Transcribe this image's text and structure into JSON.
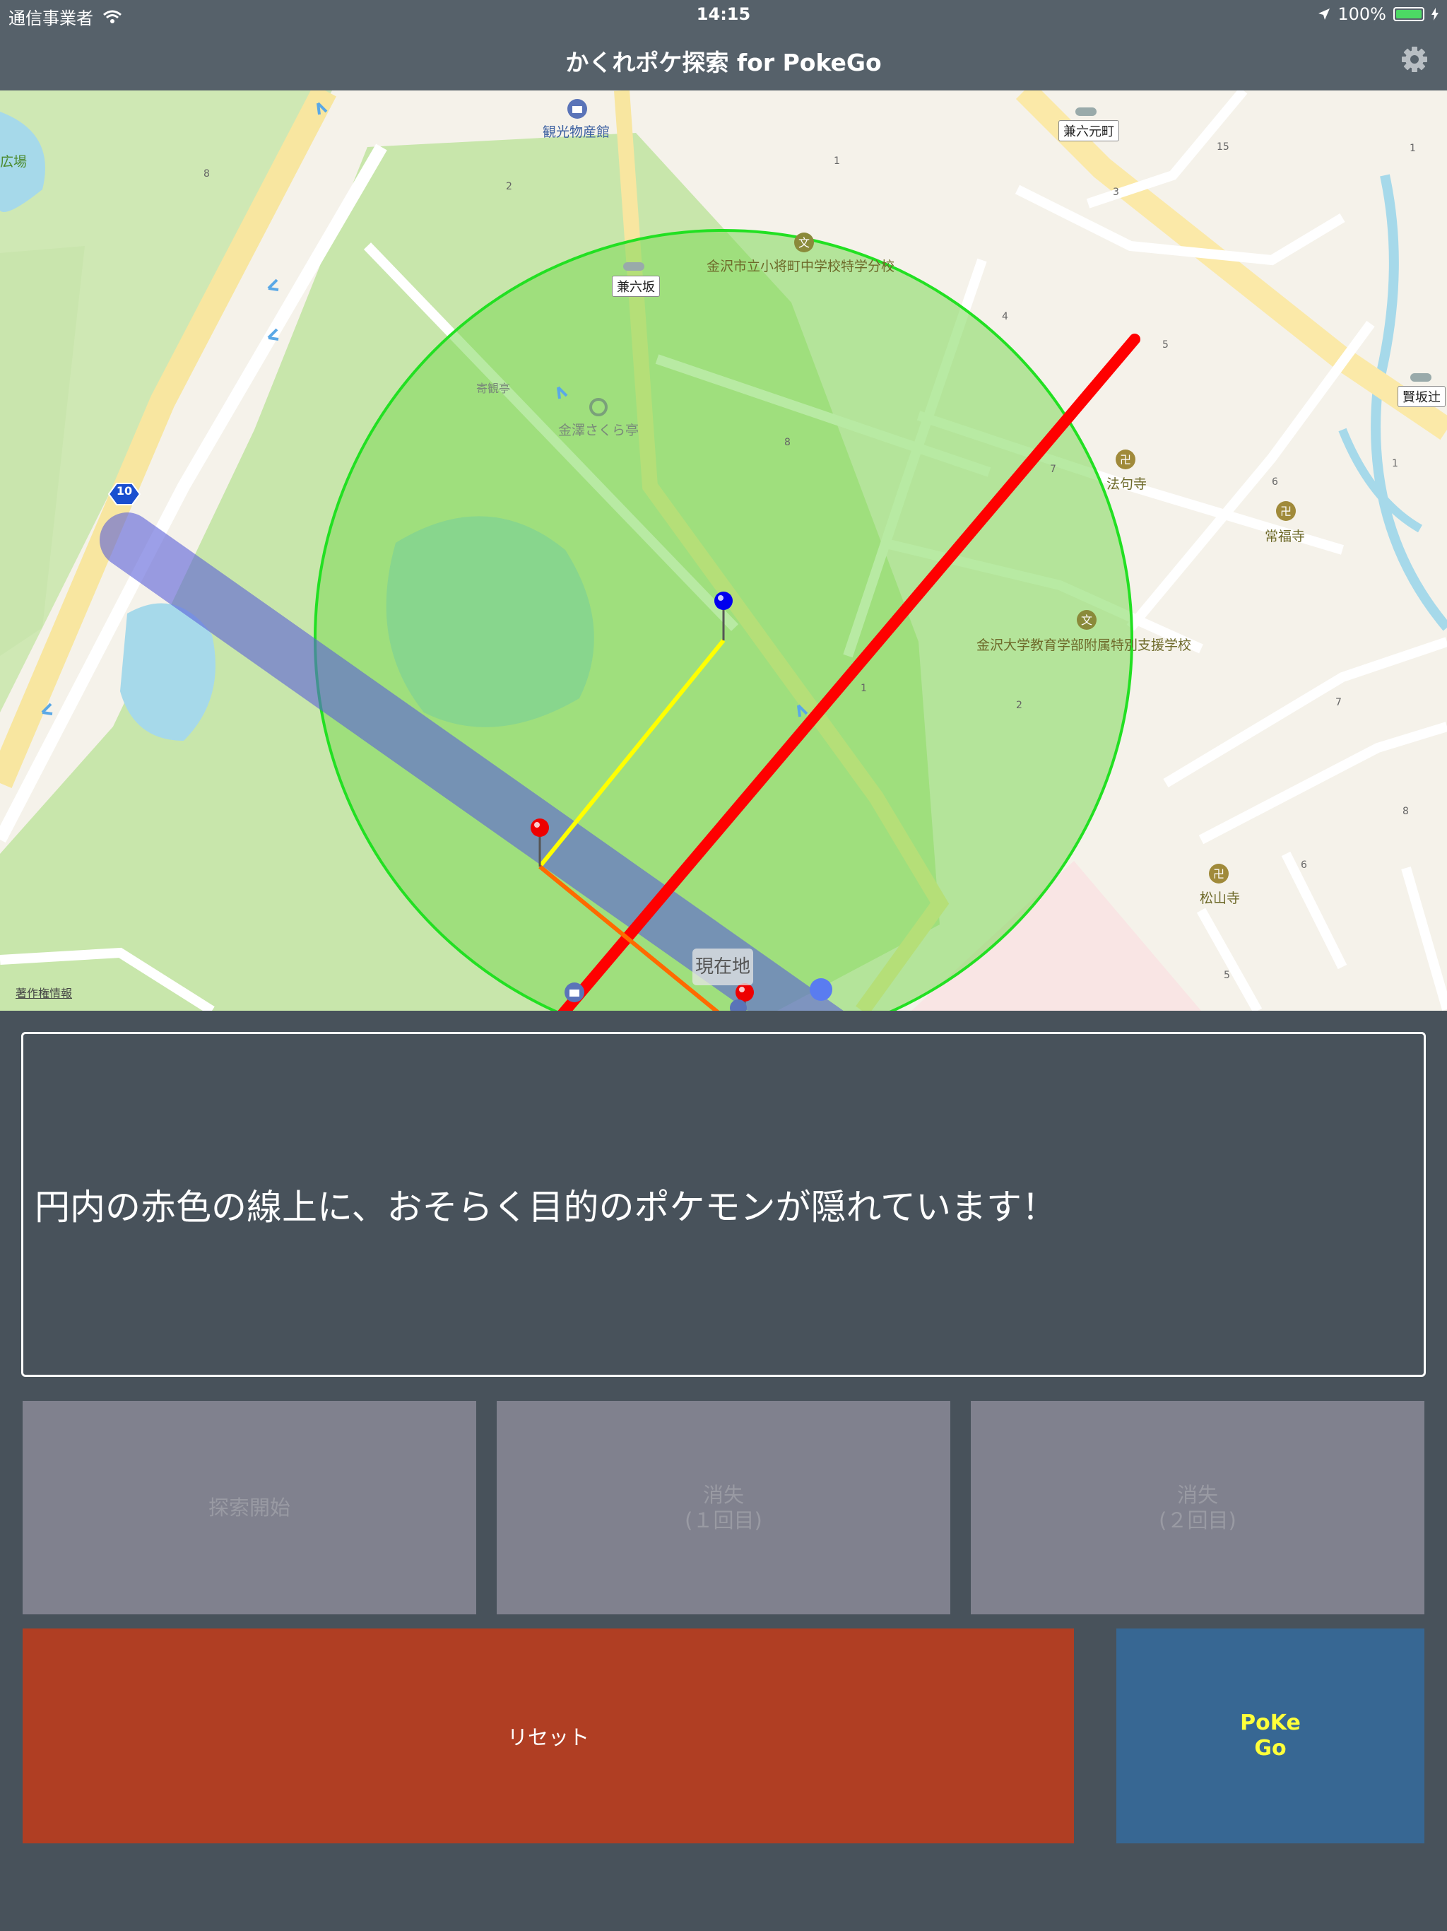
{
  "status_bar": {
    "carrier": "通信事業者",
    "time": "14:15",
    "battery": "100%",
    "battery_level": 1.0
  },
  "nav": {
    "title": "かくれポケ探索 for PokeGo",
    "settings_icon": "gear-icon"
  },
  "map": {
    "labels": {
      "hiroba": "広場",
      "kankou": "観光物産館",
      "kenrokumotomachi": "兼六元町",
      "school1": "金沢市立小将町中学校特学分校",
      "kenrokuzaka": "兼六坂",
      "kenzakatsuji": "賢坂辻",
      "yoshikantei": "寄観亭",
      "sakuratei": "金澤さくら亭",
      "houkuji": "法句寺",
      "joufukuji": "常福寺",
      "school2": "金沢大学教育学部附属特別支援学校",
      "shouzanji": "松山寺",
      "route": "10",
      "current_location": "現在地",
      "copyright": "著作権情報"
    },
    "block_numbers": [
      "1",
      "2",
      "3",
      "4",
      "5",
      "6",
      "7",
      "8",
      "15"
    ],
    "colors": {
      "circle_fill": "#7ed957",
      "circle_stroke": "#22e022",
      "red_line": "#ff0000",
      "yellow_line": "#ffff00",
      "orange_line": "#ff6a00",
      "blue_band": "#5a5fd8",
      "blue_pin": "#0000ee",
      "red_pin": "#ee0000"
    }
  },
  "message": "円内の赤色の線上に、おそらく目的のポケモンが隠れています！",
  "buttons": {
    "start": "探索開始",
    "vanish1_line1": "消失",
    "vanish1_line2": "(１回目)",
    "vanish2_line1": "消失",
    "vanish2_line2": "(２回目)",
    "reset": "リセット",
    "pokego_line1": "PoKe",
    "pokego_line2": "Go"
  }
}
